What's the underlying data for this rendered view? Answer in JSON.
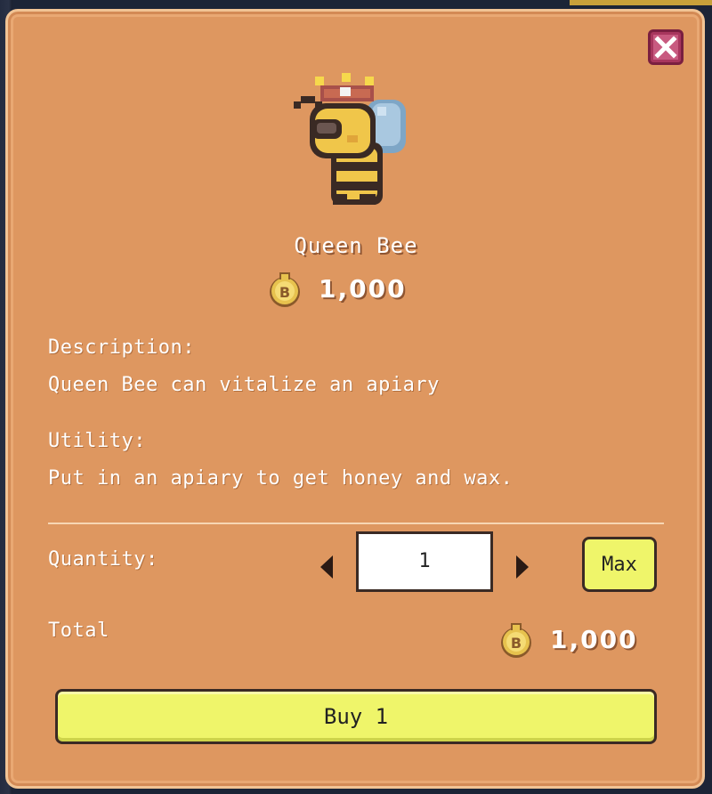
{
  "item": {
    "name": "Queen Bee",
    "price": "1,000",
    "icon": "queen-bee-sprite"
  },
  "description": {
    "heading": "Description:",
    "text": "Queen Bee can vitalize an apiary"
  },
  "utility": {
    "heading": "Utility:",
    "text": "Put in an apiary to get honey and wax."
  },
  "quantity": {
    "label": "Quantity:",
    "value": "1",
    "max_label": "Max"
  },
  "total": {
    "label": "Total",
    "value": "1,000"
  },
  "buy": {
    "label": "Buy 1"
  },
  "icons": {
    "close": "close-icon",
    "currency": "coin-icon",
    "decrease": "arrow-left-icon",
    "increase": "arrow-right-icon"
  },
  "colors": {
    "panel": "#de9760",
    "button": "#eff56a",
    "close": "#a8365e"
  }
}
